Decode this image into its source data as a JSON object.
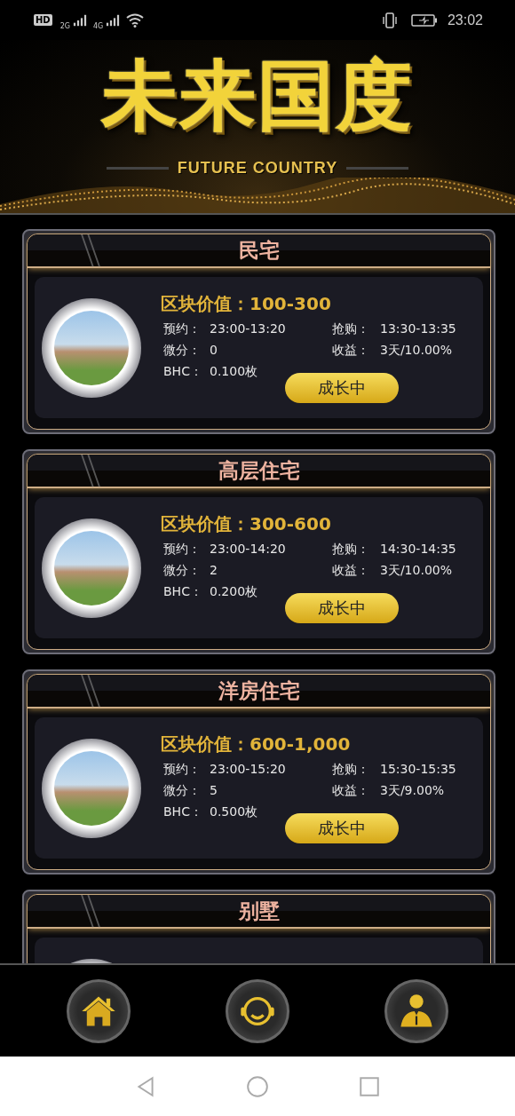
{
  "status_bar": {
    "hd": "HD",
    "sim_1": "2G",
    "sim_2": "4G",
    "time": "23:02"
  },
  "banner": {
    "title": "未来国度",
    "subtitle": "FUTURE COUNTRY"
  },
  "cards": [
    {
      "title": "民宅",
      "value": "区块价值：100-300",
      "details": [
        {
          "label": "预约：",
          "value": "23:00-13:20"
        },
        {
          "label": "抢购：",
          "value": "13:30-13:35"
        },
        {
          "label": "微分：",
          "value": "0"
        },
        {
          "label": "收益：",
          "value": "3天/10.00%"
        },
        {
          "label": "BHC：",
          "value": "0.100枚"
        }
      ],
      "button": "成长中"
    },
    {
      "title": "高层住宅",
      "value": "区块价值：300-600",
      "details": [
        {
          "label": "预约：",
          "value": "23:00-14:20"
        },
        {
          "label": "抢购：",
          "value": "14:30-14:35"
        },
        {
          "label": "微分：",
          "value": "2"
        },
        {
          "label": "收益：",
          "value": "3天/10.00%"
        },
        {
          "label": "BHC：",
          "value": "0.200枚"
        }
      ],
      "button": "成长中"
    },
    {
      "title": "洋房住宅",
      "value": "区块价值：600-1,000",
      "details": [
        {
          "label": "预约：",
          "value": "23:00-15:20"
        },
        {
          "label": "抢购：",
          "value": "15:30-15:35"
        },
        {
          "label": "微分：",
          "value": "5"
        },
        {
          "label": "收益：",
          "value": "3天/9.00%"
        },
        {
          "label": "BHC：",
          "value": "0.500枚"
        }
      ],
      "button": "成长中"
    },
    {
      "title": "别墅"
    }
  ],
  "bottom_nav": [
    {
      "kind": "home"
    },
    {
      "kind": "service"
    },
    {
      "kind": "profile"
    }
  ]
}
